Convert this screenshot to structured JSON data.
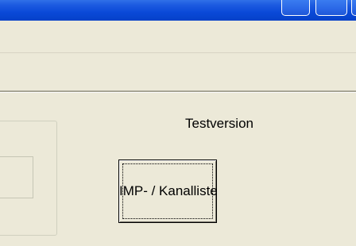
{
  "title_bar": {
    "accent_color": "#0a49d8",
    "controls": [
      "minimize-icon",
      "maximize-icon",
      "close-icon"
    ]
  },
  "label": {
    "text": "Testversion"
  },
  "button": {
    "label": "IMP- / Kanalliste"
  },
  "colors": {
    "window_bg": "#ece9d8",
    "text": "#000000"
  }
}
